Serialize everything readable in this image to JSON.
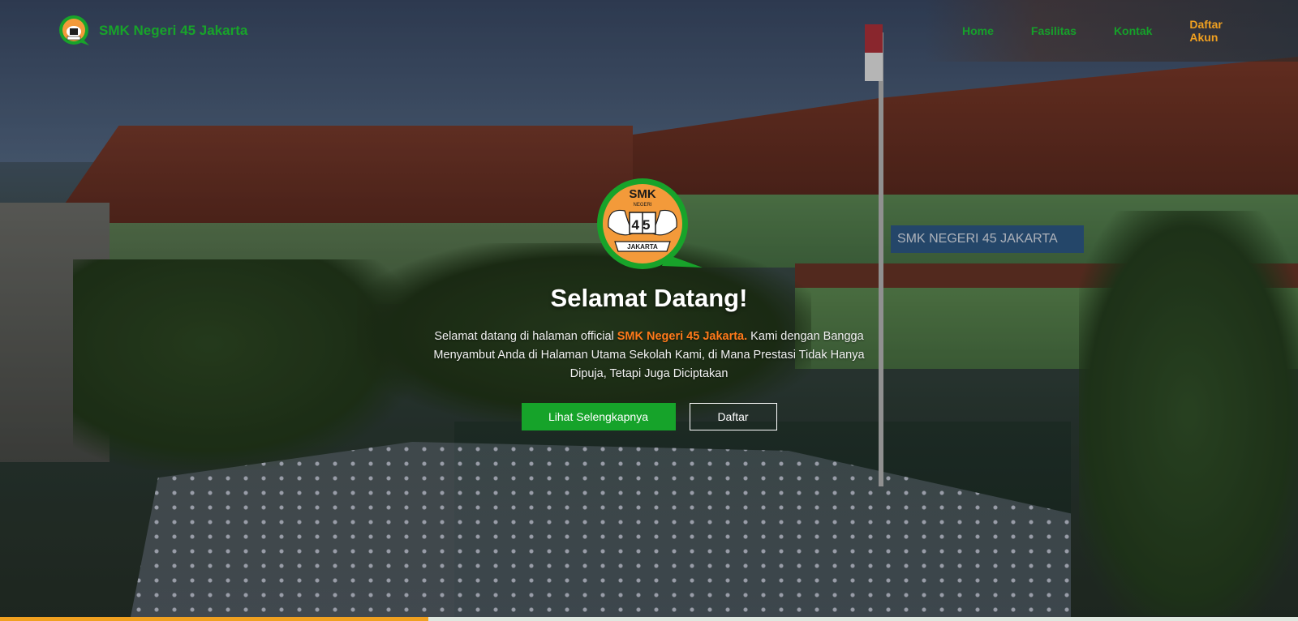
{
  "brand": {
    "name": "SMK Negeri 45 Jakarta",
    "logo_icon": "school-crest-icon"
  },
  "nav": {
    "items": [
      {
        "label": "Home"
      },
      {
        "label": "Fasilitas"
      },
      {
        "label": "Kontak"
      },
      {
        "label": "Daftar Akun"
      }
    ]
  },
  "hero": {
    "sign_text": "SMK NEGERI 45 JAKARTA",
    "headline": "Selamat Datang!",
    "intro_before": "Selamat datang di halaman official ",
    "intro_highlight": "SMK Negeri 45 Jakarta.",
    "intro_after": " Kami dengan Bangga Menyambut Anda di Halaman Utama Sekolah Kami, di Mana Prestasi Tidak Hanya Dipuja, Tetapi Juga Diciptakan",
    "primary_button": "Lihat Selengkapnya",
    "secondary_button": "Daftar"
  },
  "logo_text": {
    "top": "SMK",
    "sub": "NEGERI",
    "number": "45",
    "ribbon": "JAKARTA"
  },
  "progress": {
    "percent": 33
  },
  "colors": {
    "brand_green": "#16a32a",
    "accent_orange": "#f0a020",
    "highlight_orange": "#ff7a1a"
  }
}
